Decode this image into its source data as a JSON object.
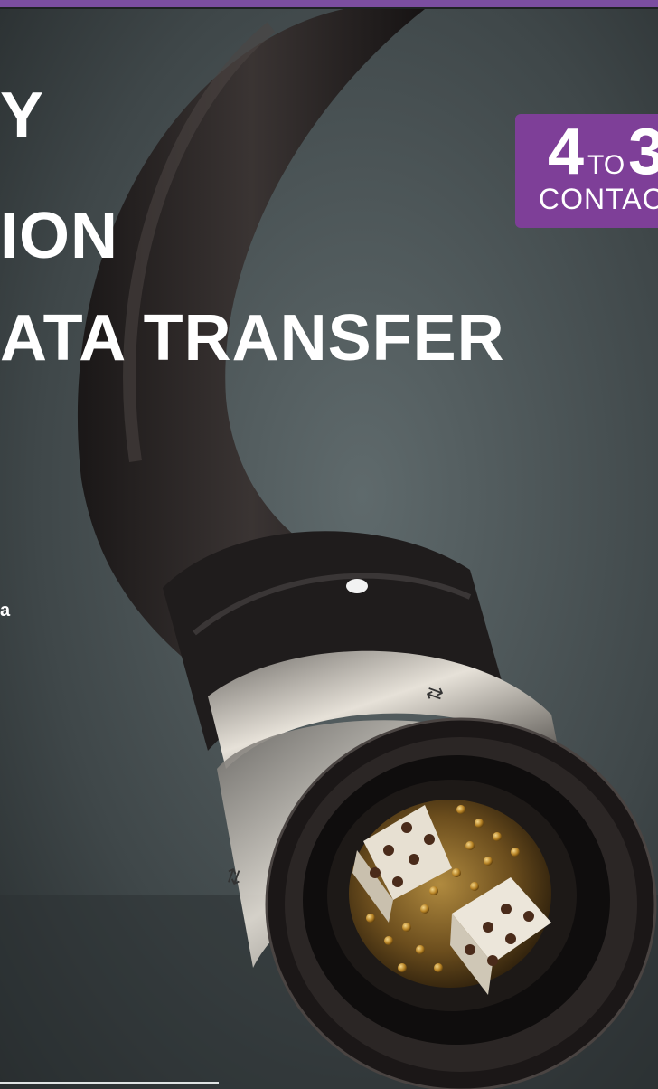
{
  "headline": {
    "line1": "Y",
    "line2": "ION",
    "line3": "ATA TRANSFER"
  },
  "side_text": "a",
  "badge": {
    "from": "4",
    "to_word": "TO",
    "to": "3",
    "unit": "CONTAC"
  },
  "colors": {
    "brand_purple": "#7e3f98",
    "background": "#3b4244",
    "headline_text": "#ffffff"
  },
  "icons": {
    "connector": "circular-connector-photo"
  }
}
